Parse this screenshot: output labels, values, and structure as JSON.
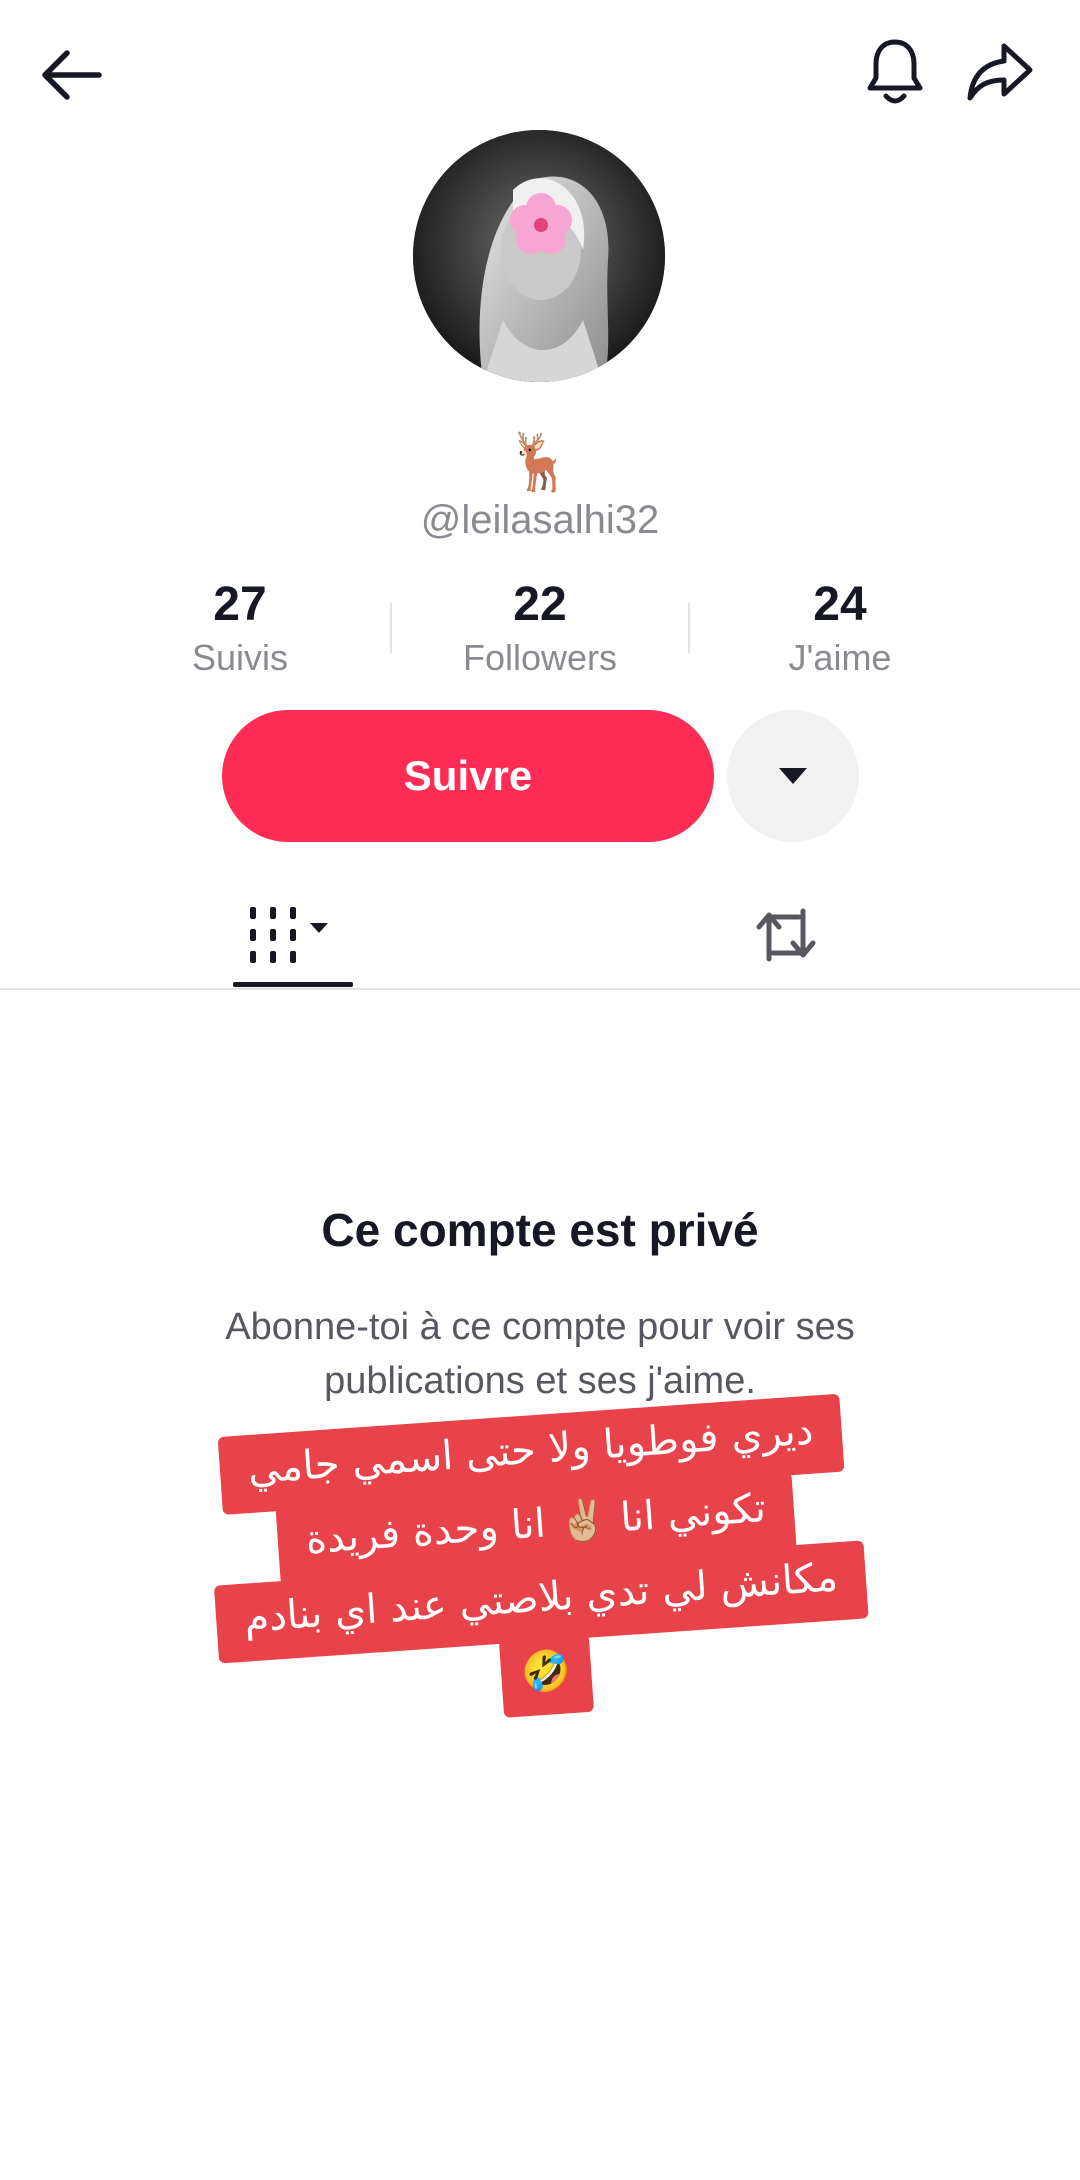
{
  "header": {
    "back_icon": "arrow-left-icon",
    "bell_icon": "bell-icon",
    "share_icon": "share-arrow-icon"
  },
  "profile": {
    "avatar_icon": "profile-photo",
    "bio_emoji": "🦌",
    "username": "@leilasalhi32"
  },
  "stats": [
    {
      "value": "27",
      "label": "Suivis"
    },
    {
      "value": "22",
      "label": "Followers"
    },
    {
      "value": "24",
      "label": "J'aime"
    }
  ],
  "actions": {
    "follow_label": "Suivre",
    "more_icon": "caret-down-icon"
  },
  "tabs": [
    {
      "name": "videos",
      "icon": "grid-icon",
      "active": true
    },
    {
      "name": "reposts",
      "icon": "repost-icon",
      "active": false
    }
  ],
  "private": {
    "title": "Ce compte est privé",
    "description": "Abonne-toi à ce compte pour voir ses publications et ses j'aime."
  },
  "sticker": {
    "lines": [
      "ديري فوطويا ولا حتى اسمي جامي",
      "تكوني انا ✌🏼 انا وحدة فريدة",
      "مكانش لي تدي بلاصتي عند اي بنادم",
      "🤣"
    ],
    "color": "#e8434a"
  },
  "colors": {
    "accent": "#fe2c55",
    "text_primary": "#161823",
    "text_secondary": "#8a8b91"
  }
}
